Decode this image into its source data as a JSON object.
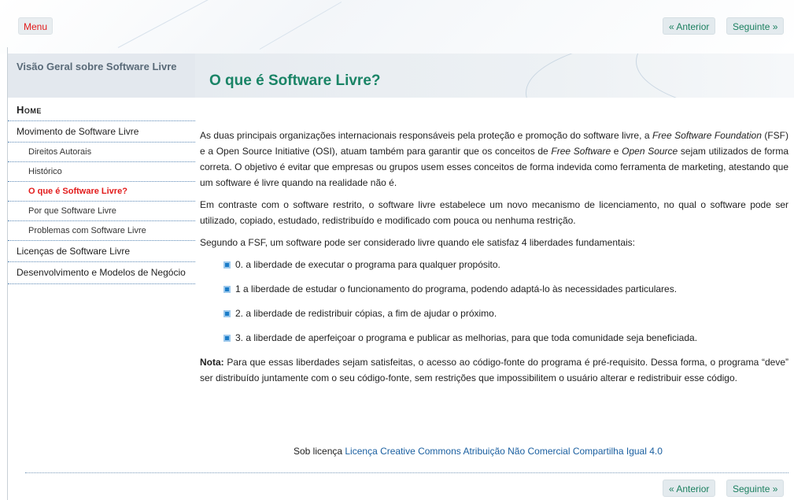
{
  "topbar": {
    "menu_label": "Menu",
    "prev_label": "« Anterior",
    "next_label": "Seguinte »"
  },
  "sidebar": {
    "heading": "Visão Geral sobre Software Livre",
    "items": [
      {
        "label": "Home"
      },
      {
        "label": "Movimento de Software Livre"
      },
      {
        "label": "Direitos Autorais"
      },
      {
        "label": "Histórico"
      },
      {
        "label": "O que é Software Livre?"
      },
      {
        "label": "Por que Software Livre"
      },
      {
        "label": "Problemas com Software Livre"
      },
      {
        "label": "Licenças de Software Livre"
      },
      {
        "label": "Desenvolvimento e Modelos de Negócio"
      }
    ]
  },
  "main": {
    "title": "O que é Software Livre?",
    "p1_a": "As duas principais organizações internacionais responsáveis pela proteção e promoção do software livre, a ",
    "p1_fsf": "Free Software Foundation",
    "p1_b": " (FSF) e a Open Source Initiative (OSI), atuam também para garantir que os conceitos de ",
    "p1_fs": "Free Software",
    "p1_c": " e ",
    "p1_os": "Open Source",
    "p1_d": "  sejam utilizados de forma correta. O objetivo é evitar que empresas ou grupos usem esses conceitos de forma indevida como ferramenta de marketing, atestando que um software é livre quando na realidade não é.",
    "p2": "Em contraste com o software restrito, o software livre estabelece um novo mecanismo de licenciamento, no qual o software pode ser utilizado, copiado, estudado, redistribuído e modificado com pouca ou nenhuma restrição.",
    "p3": "Segundo a FSF, um software pode ser considerado livre quando ele satisfaz 4 liberdades fundamentais:",
    "freedoms": [
      "0. a liberdade de executar o programa para qualquer propósito.",
      "1 a liberdade de estudar o funcionamento do programa, podendo adaptá-lo às necessidades particulares.",
      "2. a liberdade de redistribuir cópias, a fim de ajudar o próximo.",
      "3. a liberdade de aperfeiçoar o programa e publicar as melhorias, para que toda comunidade seja beneficiada."
    ],
    "note_label": "Nota:",
    "note_text": " Para que essas liberdades sejam satisfeitas, o acesso ao código-fonte do programa é pré-requisito. Dessa forma, o programa “deve” ser distribuído juntamente com o seu código-fonte, sem restrições que impossibilitem o usuário alterar e redistribuir esse código.",
    "license_prefix": "Sob licença ",
    "license_link": "Licença Creative Commons Atribuição Não Comercial Compartilha Igual 4.0"
  },
  "colors": {
    "accent_green": "#1a8466",
    "active_red": "#e21b1b",
    "link_blue": "#1a5fa0"
  }
}
